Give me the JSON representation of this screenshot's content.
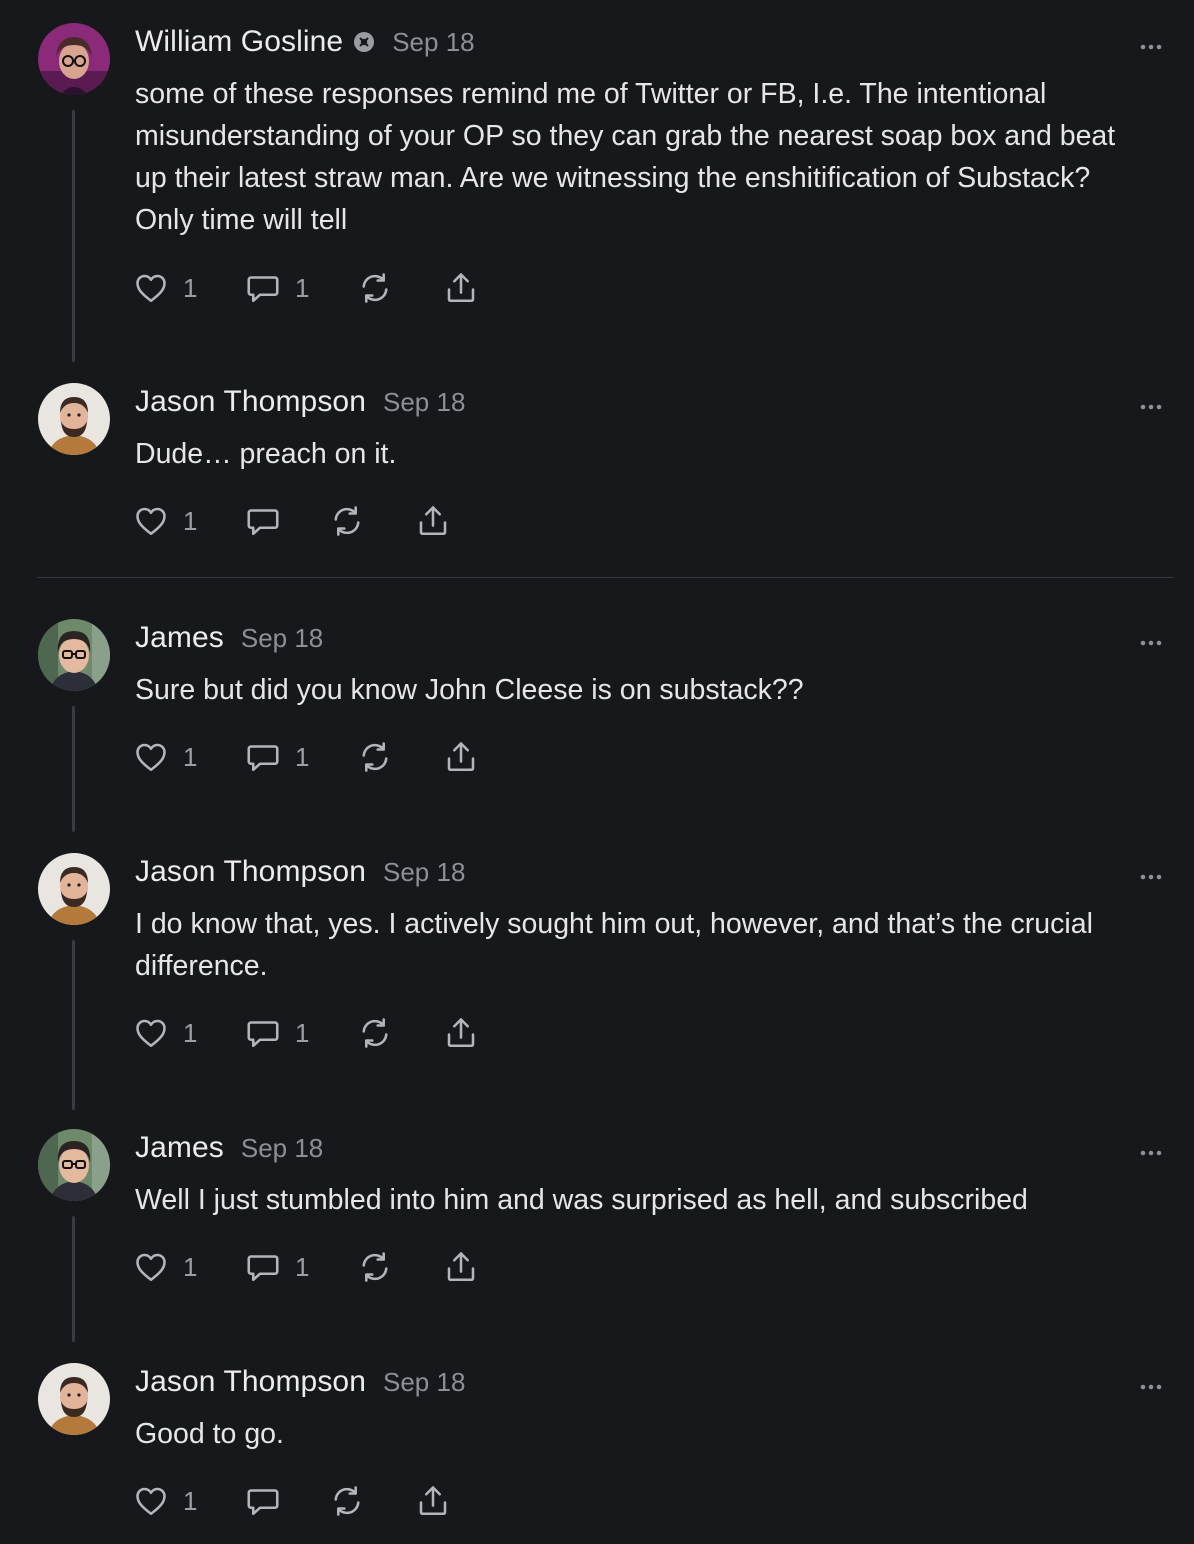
{
  "comments": [
    {
      "author": "William Gosline",
      "date": "Sep 18",
      "text": "some of these responses remind me of Twitter or FB, I.e. The intentional misunderstanding of your OP so they can grab the nearest soap box and beat up their latest straw man. Are we witnessing the enshitification of Substack? Only time will tell",
      "like_count": "1",
      "reply_count": "1"
    },
    {
      "author": "Jason Thompson",
      "date": "Sep 18",
      "text": "Dude… preach on it.",
      "like_count": "1",
      "reply_count": ""
    },
    {
      "author": "James",
      "date": "Sep 18",
      "text": "Sure but did you know John Cleese is on substack??",
      "like_count": "1",
      "reply_count": "1"
    },
    {
      "author": "Jason Thompson",
      "date": "Sep 18",
      "text": "I do know that, yes. I actively sought him out, however, and that’s the crucial difference.",
      "like_count": "1",
      "reply_count": "1"
    },
    {
      "author": "James",
      "date": "Sep 18",
      "text": "Well I just stumbled into him and was surprised as hell, and subscribed",
      "like_count": "1",
      "reply_count": "1"
    },
    {
      "author": "Jason Thompson",
      "date": "Sep 18",
      "text": "Good to go.",
      "like_count": "1",
      "reply_count": ""
    }
  ],
  "icons": {
    "like": "heart-icon",
    "reply": "comment-bubble-icon",
    "restack": "restack-icon",
    "share": "share-icon",
    "more": "more-dots-icon",
    "badge": "subscriber-badge-icon"
  },
  "colors": {
    "background": "#17181b",
    "text": "#e6e6e8",
    "muted": "#8d8f95",
    "icon": "#b4b5ba",
    "thread_line": "#3a3b40"
  }
}
